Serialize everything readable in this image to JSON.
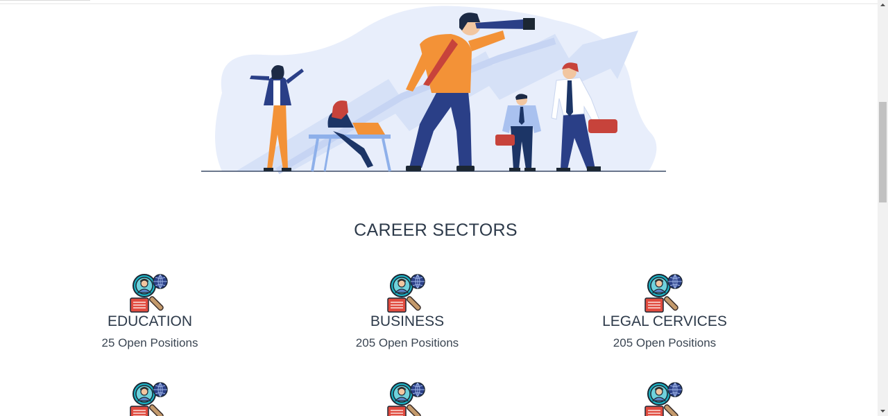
{
  "section_title": "CAREER SECTORS",
  "sectors": [
    {
      "name": "EDUCATION",
      "count": "25 Open Positions"
    },
    {
      "name": "BUSINESS",
      "count": "205 Open Positions"
    },
    {
      "name": "LEGAL CERVICES",
      "count": "205 Open Positions"
    },
    {
      "name": "",
      "count": ""
    },
    {
      "name": "",
      "count": ""
    },
    {
      "name": "",
      "count": ""
    }
  ],
  "icon": "job-search-icon",
  "colors": {
    "heading": "#2d3a4a",
    "accent_orange": "#f39237",
    "accent_navy": "#2a3f87",
    "hero_bg": "#e8eefb",
    "icon_teal": "#1bb3c4",
    "icon_red": "#e04b3f"
  }
}
